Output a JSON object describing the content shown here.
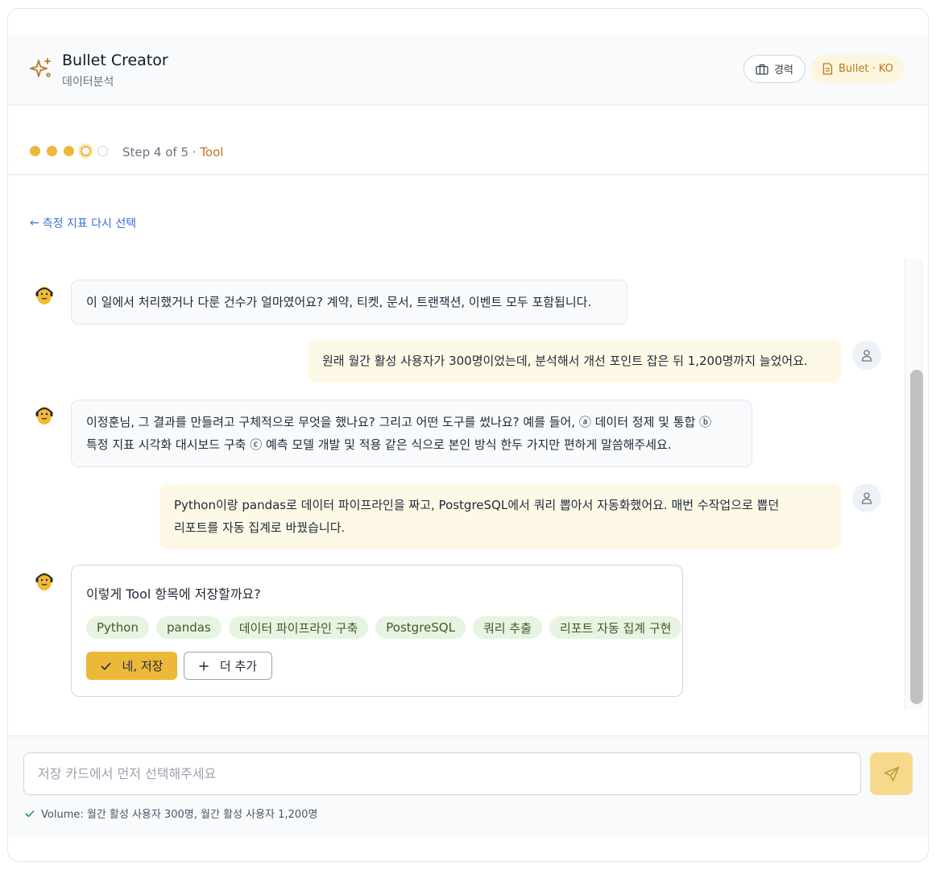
{
  "header": {
    "title": "Bullet Creator",
    "subtitle": "데이터분석",
    "career_chip": "경력",
    "bullet_chip": "Bullet · KO"
  },
  "stepper": {
    "current": 4,
    "total": 5,
    "label_prefix": "Step 4 of 5 · ",
    "label_accent": "Tool"
  },
  "back_link": "측정 지표 다시 선택",
  "messages": [
    {
      "role": "bot",
      "lines": [
        "이 일에서 처리했거나 다룬 건수가 얼마였어요? 계약, 티켓, 문서, 트랜잭션, 이벤트 모두 포함됩니다."
      ]
    },
    {
      "role": "user",
      "lines": [
        "원래 월간 활성 사용자가 300명이었는데, 분석해서 개선 포인트 잡은 뒤 1,200명까지 늘었어요."
      ]
    },
    {
      "role": "bot",
      "lines": [
        "이정훈님, 그 결과를 만들려고 구체적으로 무엇을 했나요? 그리고 어떤 도구를 썼나요? 예를 들어, ⓐ 데이터 정제 및 통합 ⓑ",
        "특정 지표 시각화 대시보드 구축 ⓒ 예측 모델 개발 및 적용 같은 식으로 본인 방식 한두 가지만 편하게 말씀해주세요."
      ]
    },
    {
      "role": "user",
      "lines": [
        "Python이랑 pandas로 데이터 파이프라인을 짜고, PostgreSQL에서 쿼리 뽑아서 자동화했어요. 매번 수작업으로 뽑던",
        "리포트를 자동 집계로 바꿨습니다."
      ]
    }
  ],
  "confirm_card": {
    "question": "이렇게 Tool 항목에 저장할까요?",
    "tags": [
      "Python",
      "pandas",
      "데이터 파이프라인 구축",
      "PostgreSQL",
      "쿼리 추출",
      "리포트 자동 집계 구현"
    ],
    "save_label": "네, 저장",
    "more_label": "더 추가"
  },
  "composer": {
    "placeholder": "저장 카드에서 먼저 선택해주세요",
    "value": "",
    "note": "Volume: 월간 활성 사용자 300명, 월간 활성 사용자 1,200명"
  },
  "colors": {
    "accent": "#ecb83a",
    "accent_text": "#b7791f",
    "link": "#3b6fd8",
    "tag_bg": "#e6f4e1",
    "user_bubble": "#fef9e7"
  },
  "icons": {
    "app": "sparkles-icon",
    "career": "briefcase-icon",
    "bullet": "document-icon",
    "bot": "bot-avatar-icon",
    "user": "user-icon",
    "send": "send-icon",
    "check": "check-icon",
    "plus": "plus-icon",
    "back": "arrow-left-icon"
  }
}
